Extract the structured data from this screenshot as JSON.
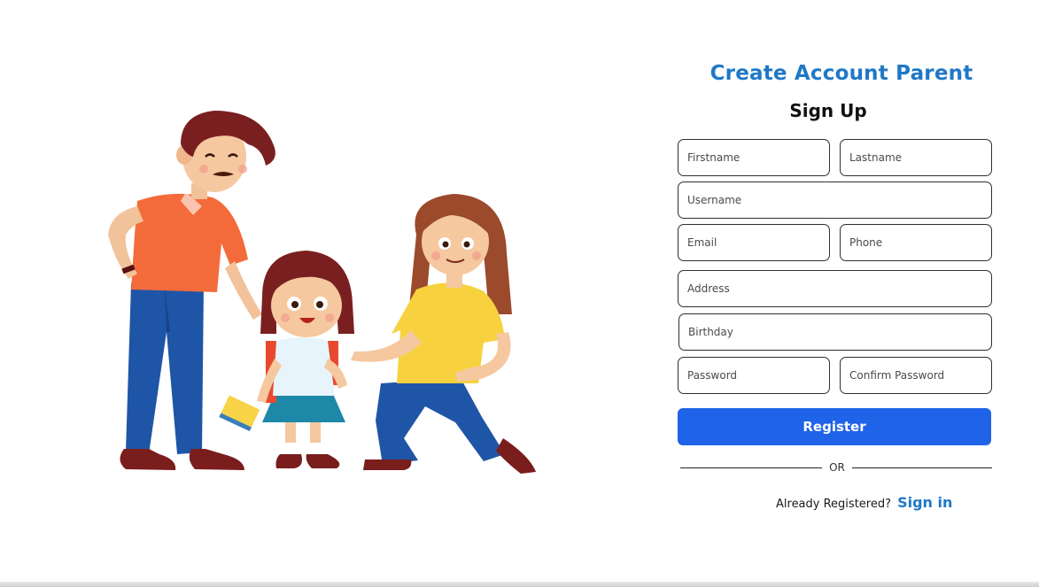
{
  "form": {
    "title": "Create Account Parent",
    "subtitle": "Sign Up",
    "fields": {
      "firstname": "Firstname",
      "lastname": "Lastname",
      "username": "Username",
      "email": "Email",
      "phone": "Phone",
      "address": "Address",
      "birthday": "Birthday",
      "password": "Password",
      "confirm_password": "Confirm Password"
    },
    "register_label": "Register",
    "divider_text": "OR",
    "signin_prompt": "Already Registered?",
    "signin_link": "Sign in"
  },
  "colors": {
    "title": "#1f78c6",
    "button": "#1f63e8",
    "link": "#1f78c6"
  }
}
